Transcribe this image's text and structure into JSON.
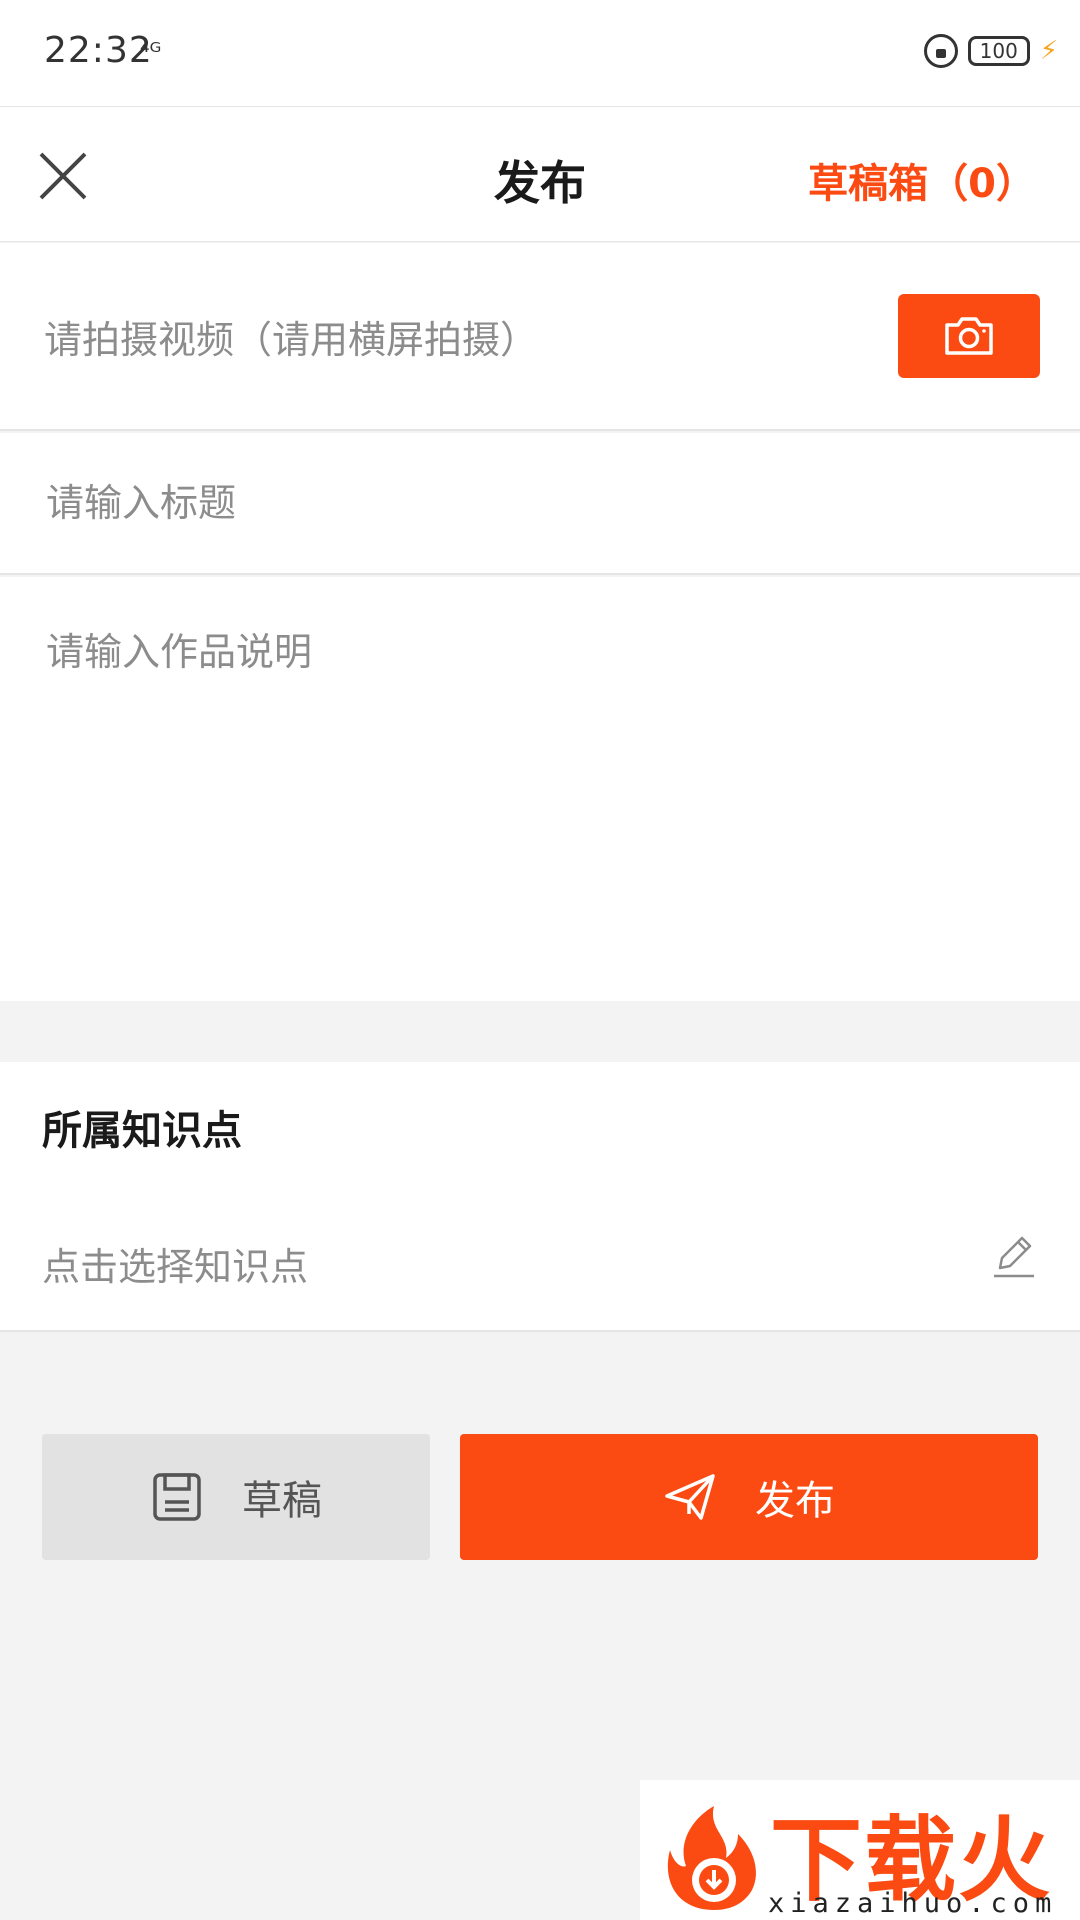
{
  "status_bar": {
    "time": "22:32",
    "signal": "⁴ᴳ",
    "battery": "100"
  },
  "header": {
    "title": "发布",
    "drafts_link": "草稿箱（0）",
    "close_icon": "close-icon"
  },
  "video": {
    "placeholder": "请拍摄视频（请用横屏拍摄）",
    "camera_icon": "camera-icon"
  },
  "form": {
    "title_placeholder": "请输入标题",
    "title_value": "",
    "description_placeholder": "请输入作品说明",
    "description_value": ""
  },
  "knowledge": {
    "heading": "所属知识点",
    "placeholder": "点击选择知识点",
    "edit_icon": "edit-icon"
  },
  "actions": {
    "draft_label": "草稿",
    "publish_label": "发布"
  },
  "watermark": {
    "brand": "下载火",
    "domain": "xiazaihuo.com"
  },
  "colors": {
    "accent": "#fb4a12",
    "background": "#f3f3f3",
    "surface": "#ffffff",
    "placeholder": "#8c8c8c",
    "draft_button": "#e2e2e2"
  }
}
